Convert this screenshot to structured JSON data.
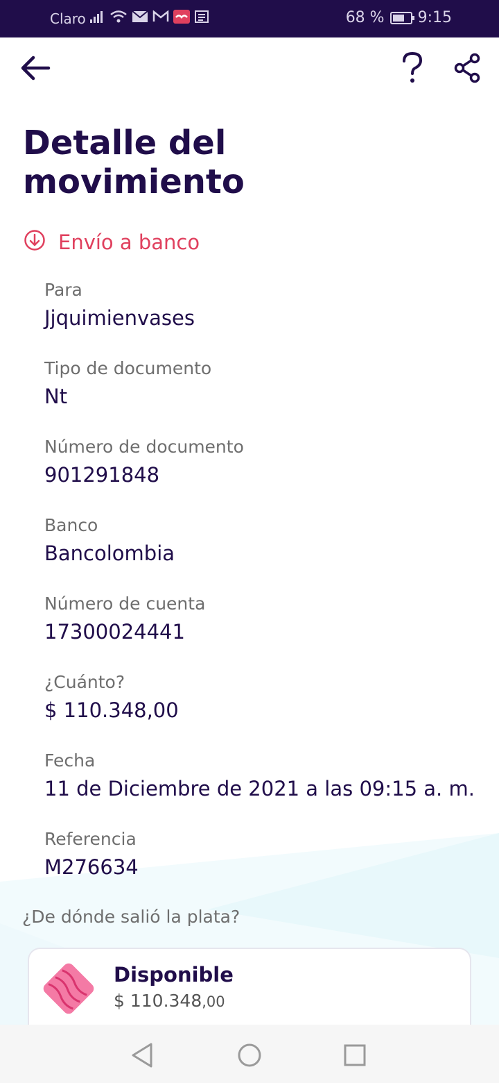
{
  "status_bar": {
    "carrier": "Claro",
    "battery": "68 %",
    "battery_level": 0.68,
    "time": "9:15"
  },
  "toolbar": {
    "back_icon": "arrow-left-icon",
    "help_icon": "question-icon",
    "share_icon": "share-icon"
  },
  "page_title": "Detalle del movimiento",
  "transaction_type": {
    "icon": "arrow-down-circle-icon",
    "label": "Envío a banco",
    "color": "#e0405e"
  },
  "details": [
    {
      "label": "Para",
      "value": "Jjquimienvases"
    },
    {
      "label": "Tipo de documento",
      "value": "Nt"
    },
    {
      "label": "Número de documento",
      "value": "901291848"
    },
    {
      "label": "Banco",
      "value": "Bancolombia"
    },
    {
      "label": "Número de cuenta",
      "value": "17300024441"
    },
    {
      "label": "¿Cuánto?",
      "value": "$ 110.348,00"
    },
    {
      "label": "Fecha",
      "value": "11 de Diciembre de 2021 a las 09:15 a. m."
    },
    {
      "label": "Referencia",
      "value": "M276634"
    }
  ],
  "source": {
    "question": "¿De dónde salió la plata?",
    "card_title": "Disponible",
    "card_amount_main": "$ 110.348",
    "card_amount_decimals": ",00"
  },
  "colors": {
    "primary": "#200d4a",
    "accent": "#e0405e"
  }
}
